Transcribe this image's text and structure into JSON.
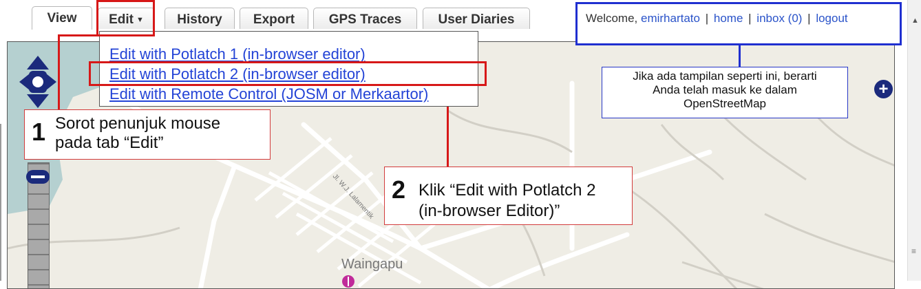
{
  "tabs": [
    {
      "label": "View",
      "active": true
    },
    {
      "label": "Edit",
      "dropdown": true
    },
    {
      "label": "History"
    },
    {
      "label": "Export"
    },
    {
      "label": "GPS Traces"
    },
    {
      "label": "User Diaries"
    }
  ],
  "welcome": {
    "prefix": "Welcome,",
    "username": "emirhartato",
    "home": "home",
    "inbox": "inbox (0)",
    "logout": "logout",
    "separator": "|"
  },
  "edit_menu": {
    "items": [
      "Edit with Potlatch 1 (in-browser editor)",
      "Edit with Potlatch 2 (in-browser editor)",
      "Edit with Remote Control (JOSM or Merkaartor)"
    ]
  },
  "callouts": {
    "step1": {
      "number": "1",
      "text_line1": "Sorot penunjuk mouse",
      "text_line2": "pada tab “Edit”"
    },
    "step2": {
      "number": "2",
      "text_line1": "Klik “Edit with Potlatch 2",
      "text_line2": "(in-browser Editor)”"
    },
    "note": {
      "line1": "Jika ada tampilan seperti ini, berarti",
      "line2": "Anda telah masuk ke dalam",
      "line3": "OpenStreetMap"
    }
  },
  "map": {
    "place_label": "Waingapu",
    "street_label": "Jl. W.J. Lalamentik"
  },
  "colors": {
    "highlight_red": "#d71818",
    "highlight_blue": "#1f2fd0",
    "link_blue": "#2343d6",
    "map_land": "#efede5",
    "map_water": "#b5d0d0",
    "pan_control": "#1b2a7c"
  },
  "icons": {
    "pan": "pan-arrows-icon",
    "zoom_in": "zoom-in-icon",
    "zoom_handle": "zoom-slider-handle-icon",
    "caret": "caret-down-icon",
    "marker": "map-marker-icon"
  }
}
